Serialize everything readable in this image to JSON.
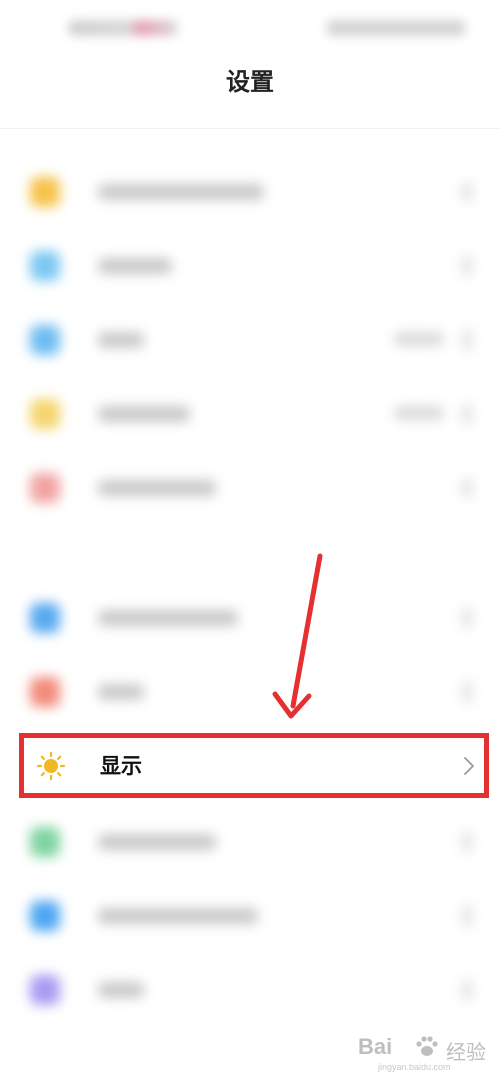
{
  "header": {
    "title": "设置"
  },
  "settings_list": {
    "highlighted_item": {
      "label": "显示",
      "icon": "sun-icon",
      "icon_color": "#f2b822",
      "highlight_color": "#e53030"
    }
  },
  "annotation": {
    "arrow_color": "#e53030"
  },
  "watermark": {
    "logo": "Bai",
    "suffix": "经验",
    "url": "jingyan.baidu.com"
  }
}
